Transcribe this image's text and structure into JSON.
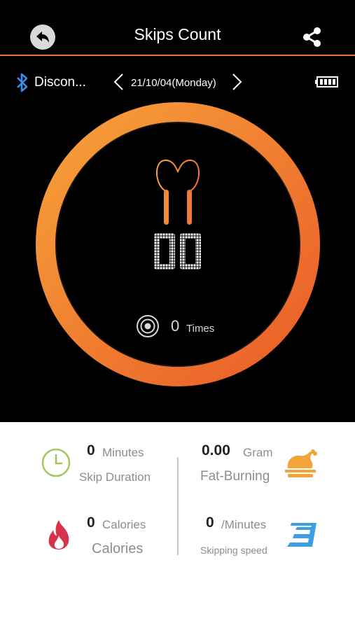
{
  "header": {
    "title": "Skips Count",
    "back_icon": "back-arrow-icon",
    "share_icon": "share-icon"
  },
  "status": {
    "bluetooth_icon": "bluetooth-icon",
    "connection": "Discon...",
    "date": "21/10/04(Monday)",
    "battery_icon": "battery-icon"
  },
  "counter": {
    "digits": "00",
    "times_value": "0",
    "times_unit": "Times"
  },
  "stats": {
    "duration": {
      "value": "0",
      "unit": "Minutes",
      "label": "Skip Duration",
      "icon": "clock-icon"
    },
    "fat": {
      "value": "0.00",
      "unit": "Gram",
      "label": "Fat-Burning",
      "icon": "roast-chicken-icon"
    },
    "calories": {
      "value": "0",
      "unit": "Calories",
      "label": "Calories",
      "icon": "flame-icon"
    },
    "speed": {
      "value": "0",
      "unit": "/Minutes",
      "label": "Skipping speed",
      "icon": "speed-icon"
    }
  },
  "colors": {
    "accent": "#f06a3a",
    "ring_light": "#f7a13a",
    "ring_dark": "#ea5c28",
    "clock": "#a3c55a",
    "chicken": "#f0a43a",
    "flame": "#d8324a",
    "speed": "#3aa0e6"
  }
}
